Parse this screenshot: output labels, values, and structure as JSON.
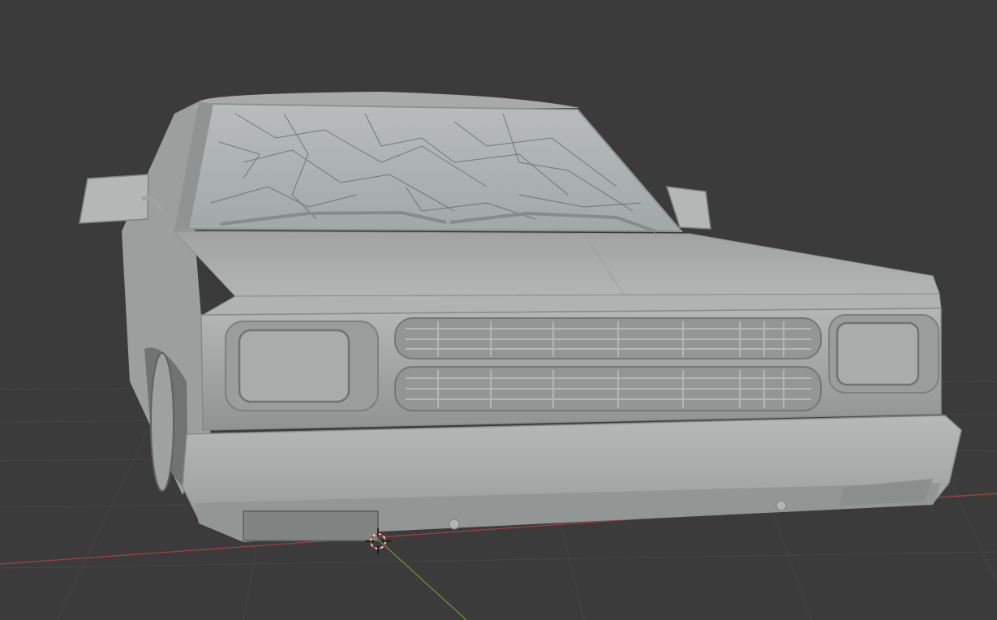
{
  "viewport": {
    "background": "#3b3b3b",
    "grid_color": "#474747",
    "x_axis_color": "#b0403f",
    "y_axis_color": "#6b9a2c"
  },
  "model": {
    "clay_color": "#a4a7a5",
    "clay_dark": "#7e8280",
    "clay_light": "#c3c6c4"
  },
  "icons": {
    "cursor": "3d-cursor-icon"
  }
}
